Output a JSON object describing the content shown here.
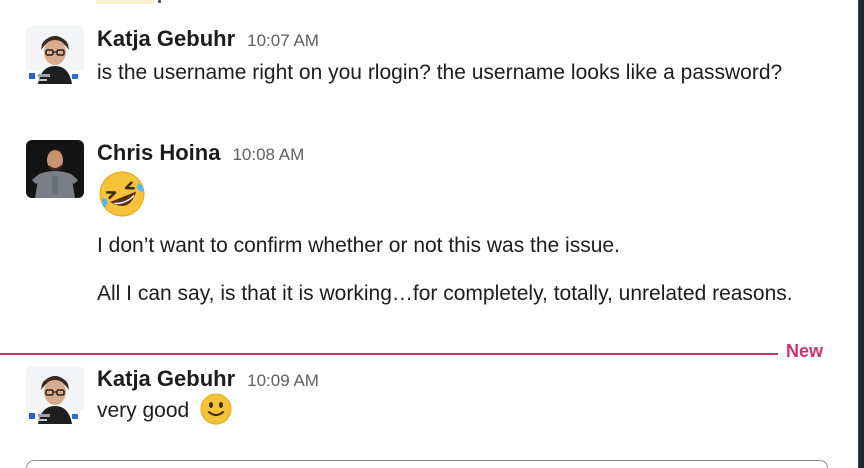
{
  "messages": [
    {
      "sender": "Katja Gebuhr",
      "time": "10:07 AM",
      "lines": [
        "is the username right on you rlogin? the username looks like a password?"
      ]
    },
    {
      "sender": "Chris Hoina",
      "time": "10:08 AM",
      "emoji": "rolling-on-floor-laughing-emoji",
      "lines": [
        "I don’t want to confirm whether or not this was the issue.",
        "All I can say, is that it is working…for completely, totally, unrelated reasons."
      ]
    },
    {
      "sender": "Katja Gebuhr",
      "time": "10:09 AM",
      "lines": [
        "very good"
      ],
      "emoji": "slightly-smiling-face-emoji"
    }
  ],
  "divider": {
    "label": "New",
    "color": "#c9356b"
  },
  "colors": {
    "text": "#1d1c1d",
    "timestamp": "#616061",
    "highlight": "#fbf1cf"
  }
}
